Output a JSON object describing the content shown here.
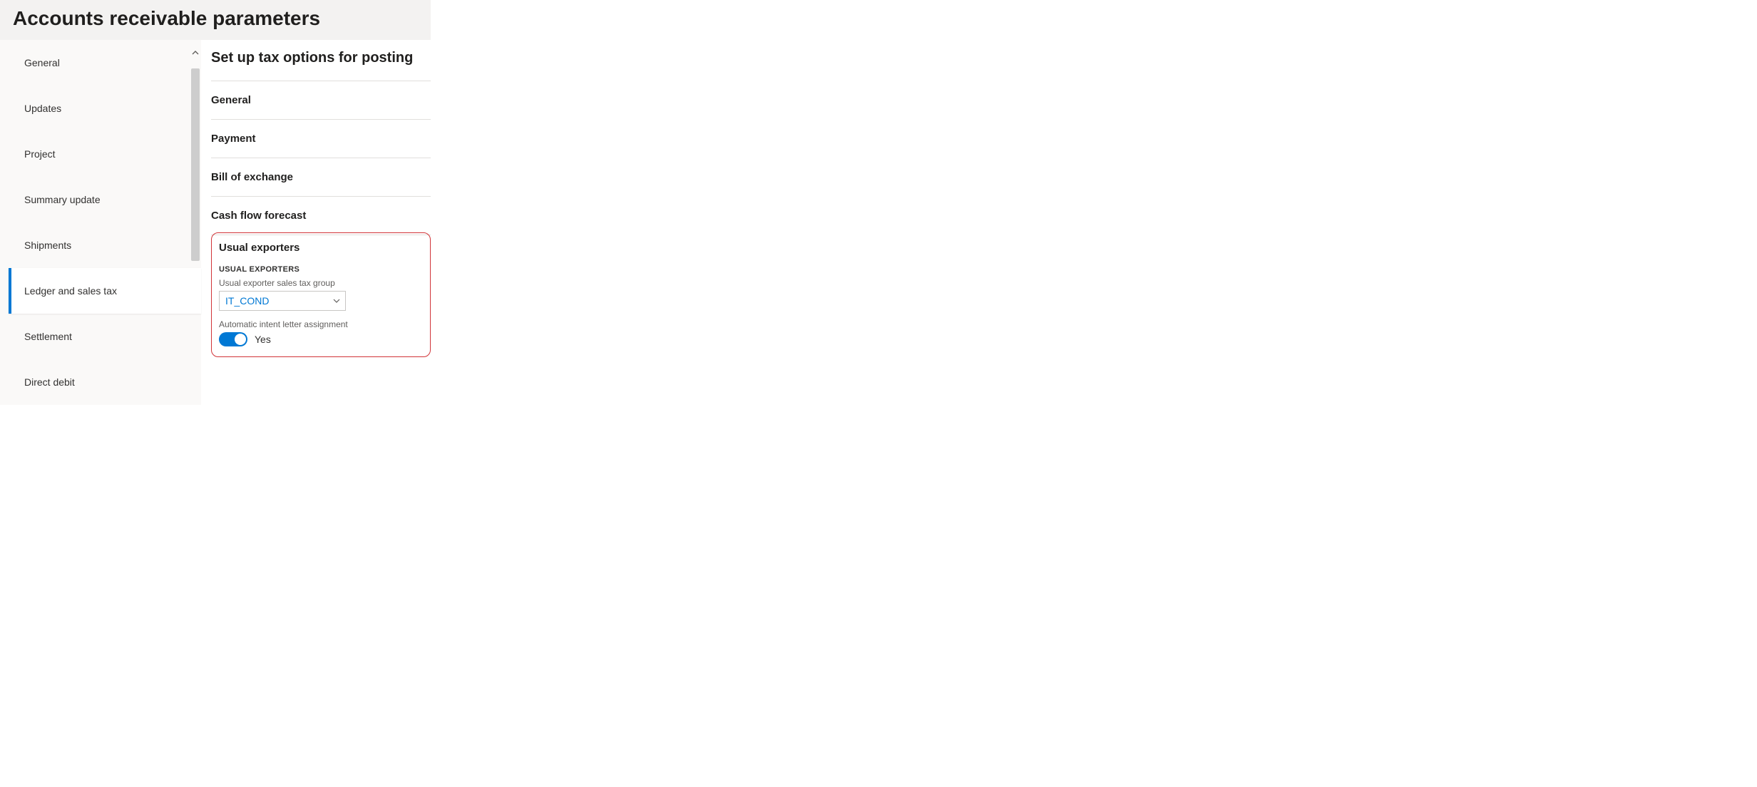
{
  "header": {
    "title": "Accounts receivable parameters"
  },
  "sidebar": {
    "items": [
      {
        "label": "General"
      },
      {
        "label": "Updates"
      },
      {
        "label": "Project"
      },
      {
        "label": "Summary update"
      },
      {
        "label": "Shipments"
      },
      {
        "label": "Ledger and sales tax"
      },
      {
        "label": "Settlement"
      },
      {
        "label": "Direct debit"
      }
    ],
    "active_index": 5
  },
  "content": {
    "title": "Set up tax options for posting",
    "sections": [
      {
        "label": "General"
      },
      {
        "label": "Payment"
      },
      {
        "label": "Bill of exchange"
      },
      {
        "label": "Cash flow forecast"
      }
    ],
    "usual_exporters": {
      "section_label": "Usual exporters",
      "group_header": "USUAL EXPORTERS",
      "tax_group_label": "Usual exporter sales tax group",
      "tax_group_value": "IT_COND",
      "auto_intent_label": "Automatic intent letter assignment",
      "auto_intent_value": "Yes"
    }
  }
}
